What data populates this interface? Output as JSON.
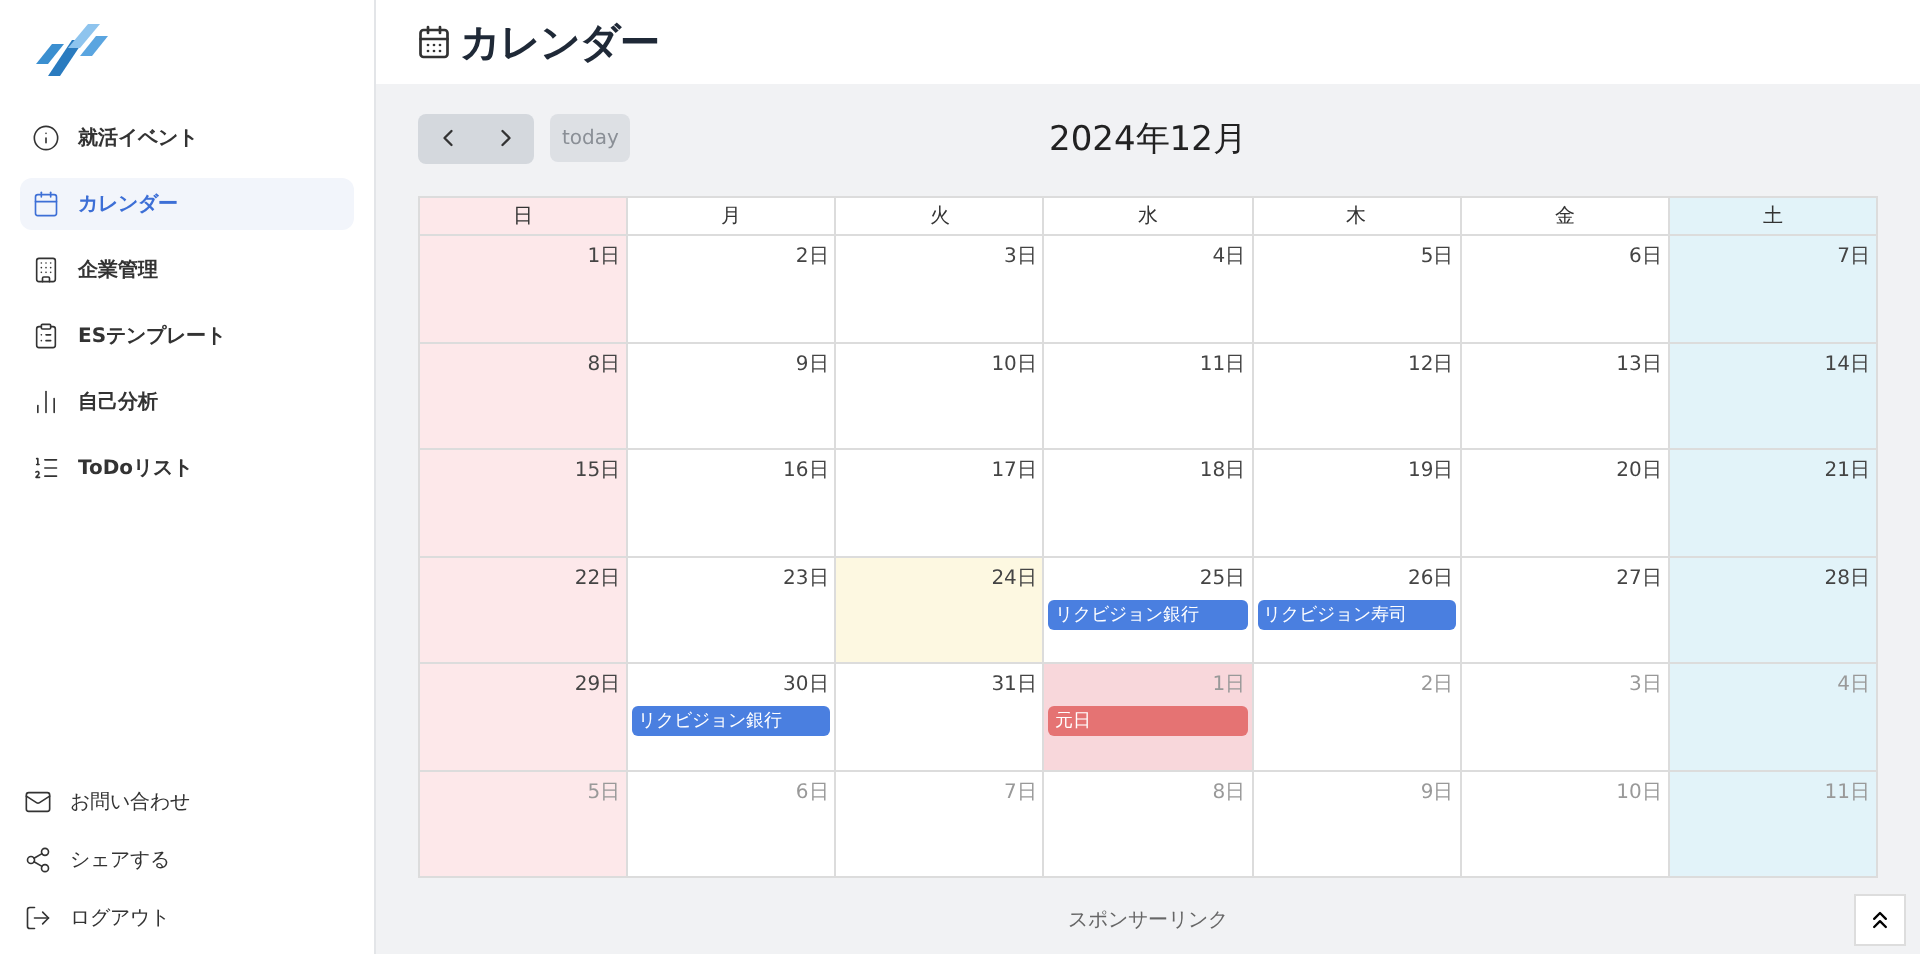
{
  "sidebar": {
    "items": [
      {
        "label": "就活イベント",
        "selected": false
      },
      {
        "label": "カレンダー",
        "selected": true
      },
      {
        "label": "企業管理",
        "selected": false
      },
      {
        "label": "ESテンプレート",
        "selected": false
      },
      {
        "label": "自己分析",
        "selected": false
      },
      {
        "label": "ToDoリスト",
        "selected": false
      }
    ],
    "footer_items": [
      {
        "label": "お問い合わせ"
      },
      {
        "label": "シェアする"
      },
      {
        "label": "ログアウト"
      }
    ]
  },
  "page_title": "カレンダー",
  "toolbar": {
    "today_button": "today",
    "today_disabled": true,
    "month_title": "2024年12月"
  },
  "weekdays": [
    {
      "label": "日",
      "kind": "sunday"
    },
    {
      "label": "月",
      "kind": "weekday"
    },
    {
      "label": "火",
      "kind": "weekday"
    },
    {
      "label": "水",
      "kind": "weekday"
    },
    {
      "label": "木",
      "kind": "weekday"
    },
    {
      "label": "金",
      "kind": "weekday"
    },
    {
      "label": "土",
      "kind": "saturday"
    }
  ],
  "weeks": [
    [
      {
        "label": "1日",
        "outside": false,
        "today": false,
        "holiday": false
      },
      {
        "label": "2日",
        "outside": false,
        "today": false,
        "holiday": false
      },
      {
        "label": "3日",
        "outside": false,
        "today": false,
        "holiday": false
      },
      {
        "label": "4日",
        "outside": false,
        "today": false,
        "holiday": false
      },
      {
        "label": "5日",
        "outside": false,
        "today": false,
        "holiday": false
      },
      {
        "label": "6日",
        "outside": false,
        "today": false,
        "holiday": false
      },
      {
        "label": "7日",
        "outside": false,
        "today": false,
        "holiday": false
      }
    ],
    [
      {
        "label": "8日",
        "outside": false,
        "today": false,
        "holiday": false
      },
      {
        "label": "9日",
        "outside": false,
        "today": false,
        "holiday": false
      },
      {
        "label": "10日",
        "outside": false,
        "today": false,
        "holiday": false
      },
      {
        "label": "11日",
        "outside": false,
        "today": false,
        "holiday": false
      },
      {
        "label": "12日",
        "outside": false,
        "today": false,
        "holiday": false
      },
      {
        "label": "13日",
        "outside": false,
        "today": false,
        "holiday": false
      },
      {
        "label": "14日",
        "outside": false,
        "today": false,
        "holiday": false
      }
    ],
    [
      {
        "label": "15日",
        "outside": false,
        "today": false,
        "holiday": false
      },
      {
        "label": "16日",
        "outside": false,
        "today": false,
        "holiday": false
      },
      {
        "label": "17日",
        "outside": false,
        "today": false,
        "holiday": false
      },
      {
        "label": "18日",
        "outside": false,
        "today": false,
        "holiday": false
      },
      {
        "label": "19日",
        "outside": false,
        "today": false,
        "holiday": false
      },
      {
        "label": "20日",
        "outside": false,
        "today": false,
        "holiday": false
      },
      {
        "label": "21日",
        "outside": false,
        "today": false,
        "holiday": false
      }
    ],
    [
      {
        "label": "22日",
        "outside": false,
        "today": false,
        "holiday": false
      },
      {
        "label": "23日",
        "outside": false,
        "today": false,
        "holiday": false
      },
      {
        "label": "24日",
        "outside": false,
        "today": true,
        "holiday": false
      },
      {
        "label": "25日",
        "outside": false,
        "today": false,
        "holiday": false,
        "events": [
          {
            "title": "リクビジョン銀行",
            "color": "#4a7fe0"
          }
        ]
      },
      {
        "label": "26日",
        "outside": false,
        "today": false,
        "holiday": false,
        "events": [
          {
            "title": "リクビジョン寿司",
            "color": "#4a7fe0"
          }
        ]
      },
      {
        "label": "27日",
        "outside": false,
        "today": false,
        "holiday": false
      },
      {
        "label": "28日",
        "outside": false,
        "today": false,
        "holiday": false
      }
    ],
    [
      {
        "label": "29日",
        "outside": false,
        "today": false,
        "holiday": false
      },
      {
        "label": "30日",
        "outside": false,
        "today": false,
        "holiday": false,
        "events": [
          {
            "title": "リクビジョン銀行",
            "color": "#4a7fe0"
          }
        ]
      },
      {
        "label": "31日",
        "outside": false,
        "today": false,
        "holiday": false
      },
      {
        "label": "1日",
        "outside": true,
        "today": false,
        "holiday": true,
        "events": [
          {
            "title": "元日",
            "color": "#e57373"
          }
        ]
      },
      {
        "label": "2日",
        "outside": true,
        "today": false,
        "holiday": false
      },
      {
        "label": "3日",
        "outside": true,
        "today": false,
        "holiday": false
      },
      {
        "label": "4日",
        "outside": true,
        "today": false,
        "holiday": false
      }
    ],
    [
      {
        "label": "5日",
        "outside": true,
        "today": false,
        "holiday": false
      },
      {
        "label": "6日",
        "outside": true,
        "today": false,
        "holiday": false
      },
      {
        "label": "7日",
        "outside": true,
        "today": false,
        "holiday": false
      },
      {
        "label": "8日",
        "outside": true,
        "today": false,
        "holiday": false
      },
      {
        "label": "9日",
        "outside": true,
        "today": false,
        "holiday": false
      },
      {
        "label": "10日",
        "outside": true,
        "today": false,
        "holiday": false
      },
      {
        "label": "11日",
        "outside": true,
        "today": false,
        "holiday": false
      }
    ]
  ],
  "sponsor_label": "スポンサーリンク"
}
